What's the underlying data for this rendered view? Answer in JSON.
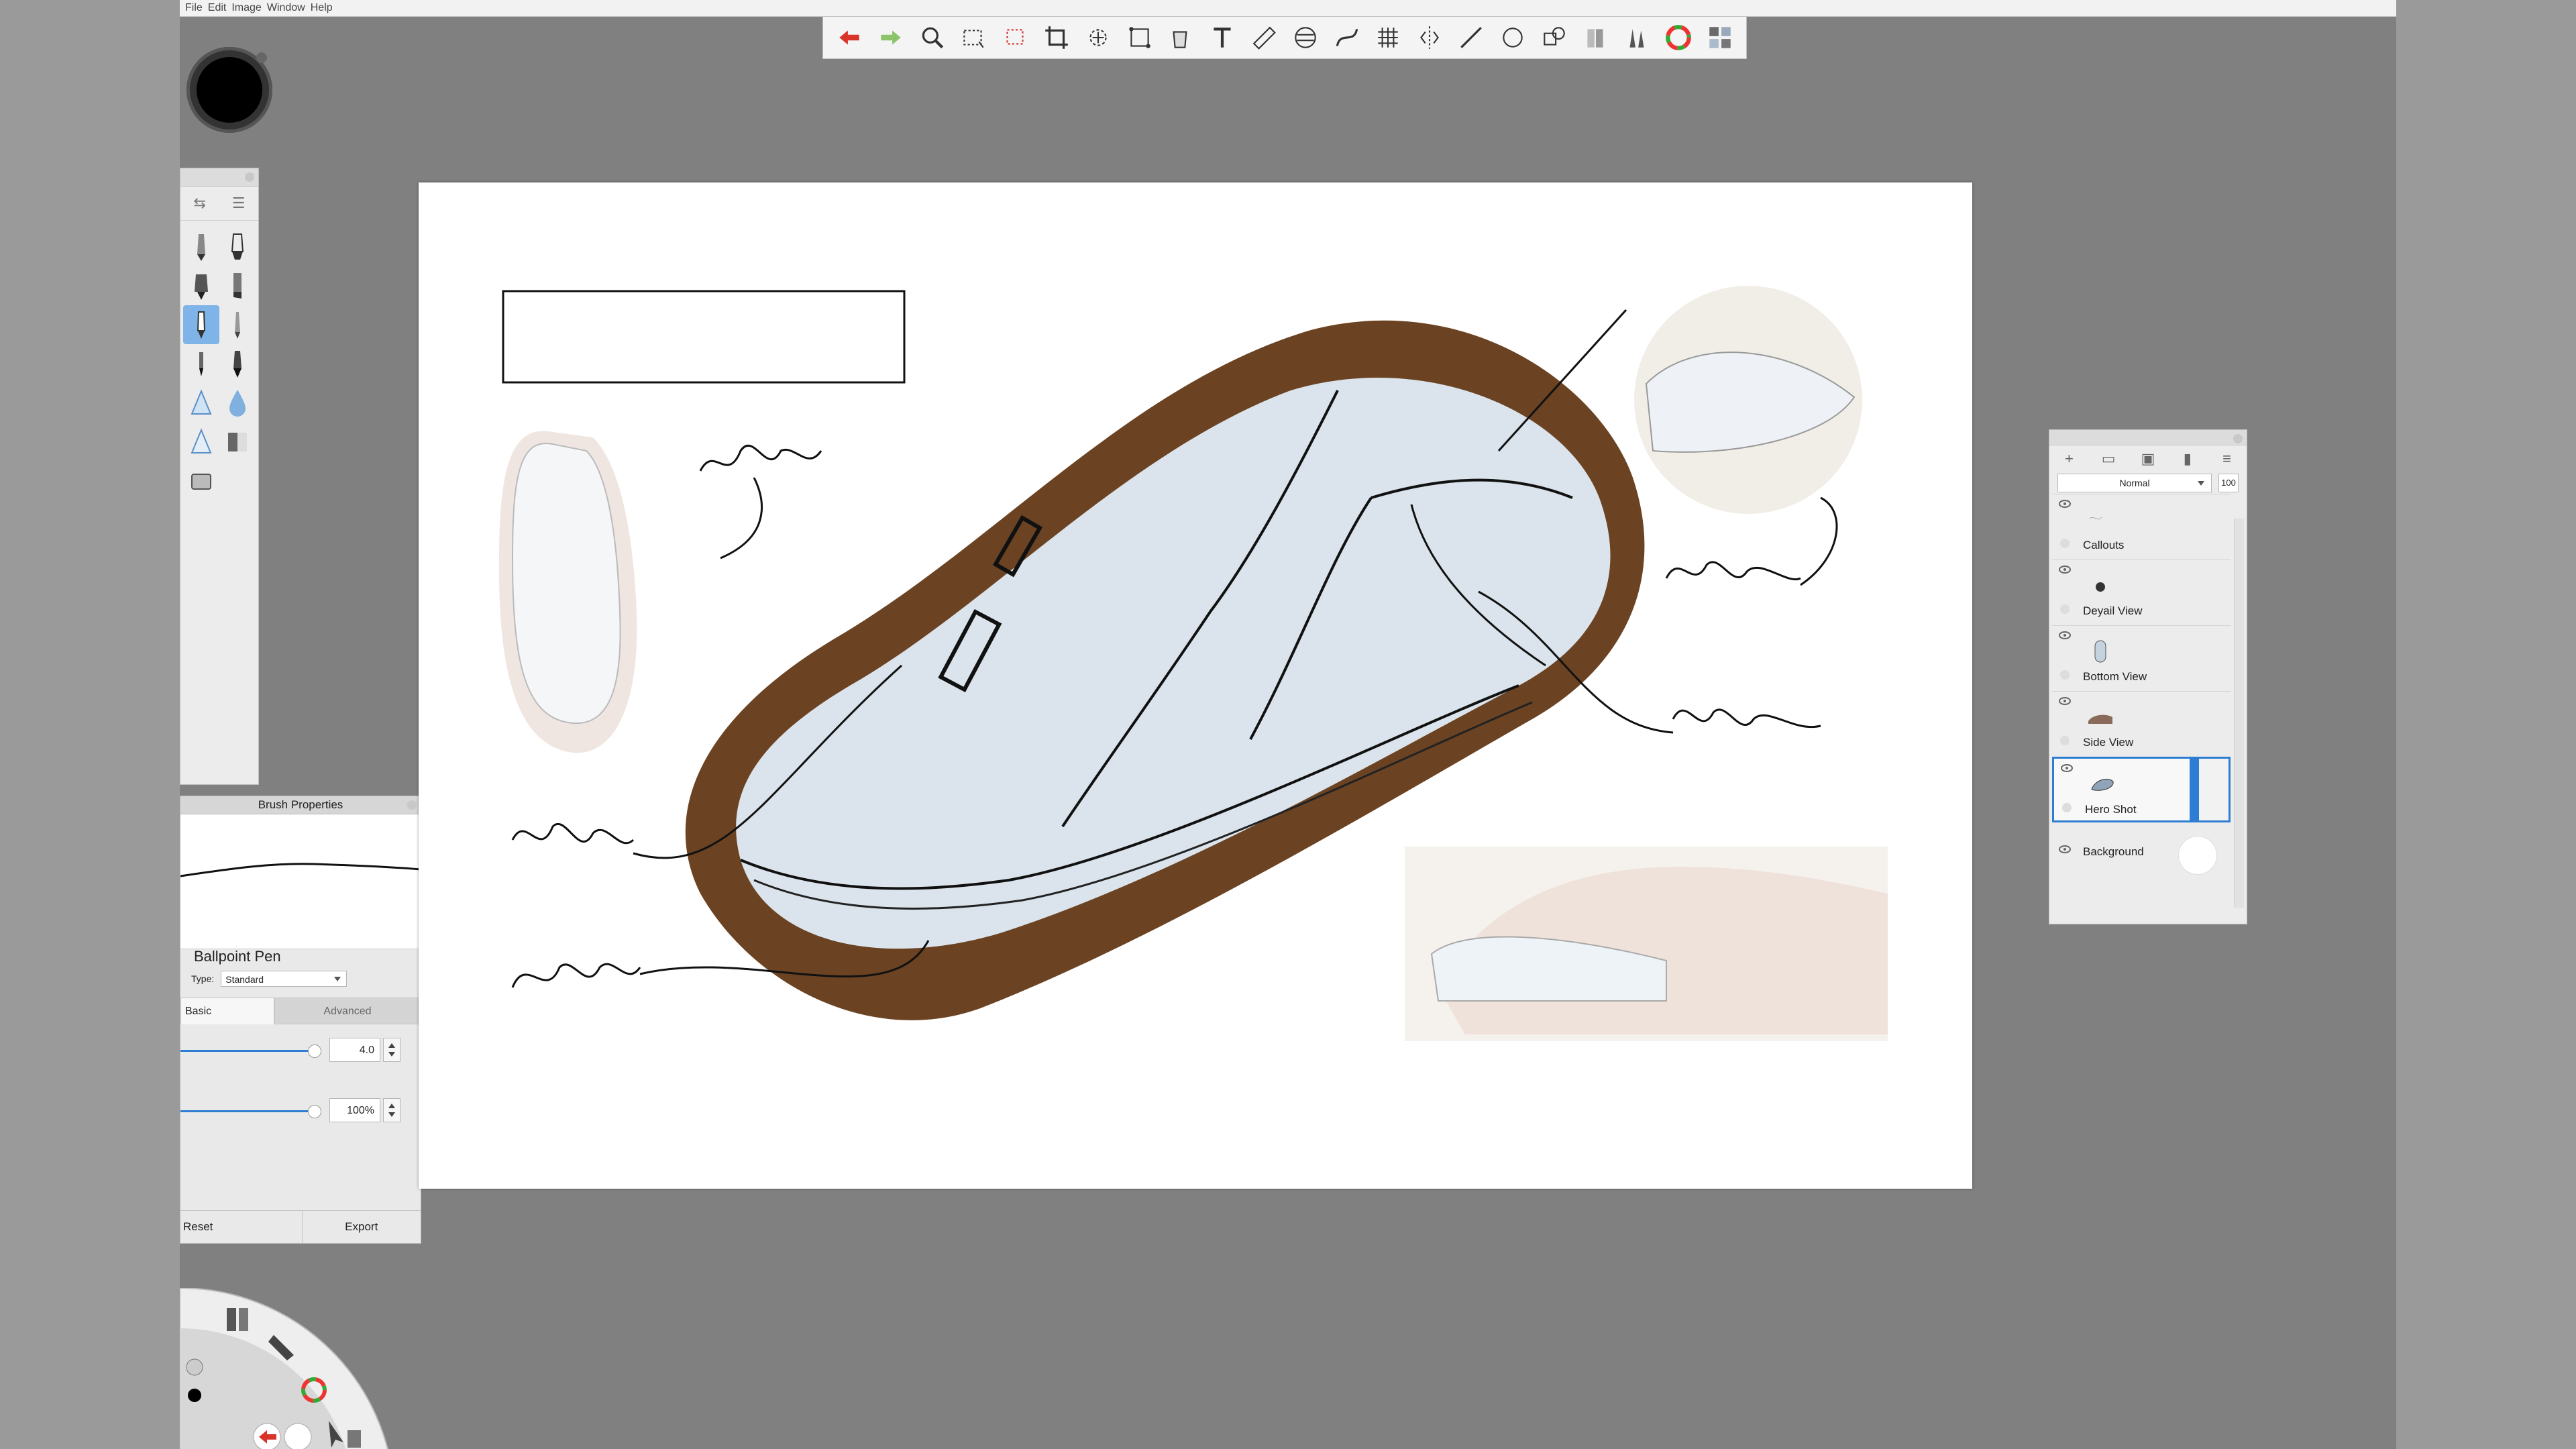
{
  "menu": [
    "File",
    "Edit",
    "Image",
    "Window",
    "Help"
  ],
  "toolbar": {
    "tools": [
      "undo-icon",
      "redo-icon",
      "zoom-icon",
      "rect-select-icon",
      "lasso-icon",
      "crop-icon",
      "transform-icon",
      "distort-icon",
      "bucket-icon",
      "text-icon",
      "ruler-icon",
      "ellipse-guide-icon",
      "french-curve-icon",
      "perspective-icon",
      "symmetry-icon",
      "line-icon",
      "circle-icon",
      "shape-icon",
      "copic-icon",
      "brush-library-icon",
      "color-wheel-icon",
      "swatches-icon"
    ]
  },
  "brush_properties": {
    "title": "Brush Properties",
    "brush_name": "Ballpoint Pen",
    "type_label": "Type:",
    "type_value": "Standard",
    "tab_basic": "Basic",
    "tab_advanced": "Advanced",
    "size_value": "4.0",
    "opacity_value": "100%",
    "reset_label": "Reset",
    "export_label": "Export"
  },
  "layers": {
    "blend_mode": "Normal",
    "opacity": "100",
    "items": [
      {
        "name": "Callouts",
        "selected": false
      },
      {
        "name": "Deyail View",
        "selected": false
      },
      {
        "name": "Bottom View",
        "selected": false
      },
      {
        "name": "Side View",
        "selected": false
      },
      {
        "name": "Hero Shot",
        "selected": true
      },
      {
        "name": "Background",
        "selected": false
      }
    ]
  },
  "colors": {
    "accent": "#2d7dd2",
    "canvas_bg": "#ffffff",
    "workspace_bg": "#808080",
    "logo_red": "#d81e1e"
  }
}
